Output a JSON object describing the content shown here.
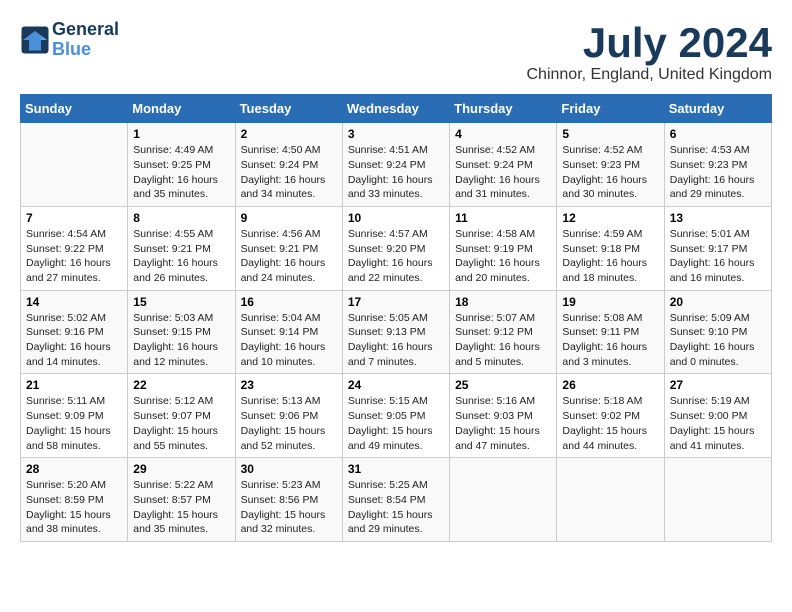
{
  "logo": {
    "line1": "General",
    "line2": "Blue"
  },
  "title": "July 2024",
  "subtitle": "Chinnor, England, United Kingdom",
  "days_of_week": [
    "Sunday",
    "Monday",
    "Tuesday",
    "Wednesday",
    "Thursday",
    "Friday",
    "Saturday"
  ],
  "weeks": [
    [
      {
        "num": "",
        "info": ""
      },
      {
        "num": "1",
        "info": "Sunrise: 4:49 AM\nSunset: 9:25 PM\nDaylight: 16 hours\nand 35 minutes."
      },
      {
        "num": "2",
        "info": "Sunrise: 4:50 AM\nSunset: 9:24 PM\nDaylight: 16 hours\nand 34 minutes."
      },
      {
        "num": "3",
        "info": "Sunrise: 4:51 AM\nSunset: 9:24 PM\nDaylight: 16 hours\nand 33 minutes."
      },
      {
        "num": "4",
        "info": "Sunrise: 4:52 AM\nSunset: 9:24 PM\nDaylight: 16 hours\nand 31 minutes."
      },
      {
        "num": "5",
        "info": "Sunrise: 4:52 AM\nSunset: 9:23 PM\nDaylight: 16 hours\nand 30 minutes."
      },
      {
        "num": "6",
        "info": "Sunrise: 4:53 AM\nSunset: 9:23 PM\nDaylight: 16 hours\nand 29 minutes."
      }
    ],
    [
      {
        "num": "7",
        "info": "Sunrise: 4:54 AM\nSunset: 9:22 PM\nDaylight: 16 hours\nand 27 minutes."
      },
      {
        "num": "8",
        "info": "Sunrise: 4:55 AM\nSunset: 9:21 PM\nDaylight: 16 hours\nand 26 minutes."
      },
      {
        "num": "9",
        "info": "Sunrise: 4:56 AM\nSunset: 9:21 PM\nDaylight: 16 hours\nand 24 minutes."
      },
      {
        "num": "10",
        "info": "Sunrise: 4:57 AM\nSunset: 9:20 PM\nDaylight: 16 hours\nand 22 minutes."
      },
      {
        "num": "11",
        "info": "Sunrise: 4:58 AM\nSunset: 9:19 PM\nDaylight: 16 hours\nand 20 minutes."
      },
      {
        "num": "12",
        "info": "Sunrise: 4:59 AM\nSunset: 9:18 PM\nDaylight: 16 hours\nand 18 minutes."
      },
      {
        "num": "13",
        "info": "Sunrise: 5:01 AM\nSunset: 9:17 PM\nDaylight: 16 hours\nand 16 minutes."
      }
    ],
    [
      {
        "num": "14",
        "info": "Sunrise: 5:02 AM\nSunset: 9:16 PM\nDaylight: 16 hours\nand 14 minutes."
      },
      {
        "num": "15",
        "info": "Sunrise: 5:03 AM\nSunset: 9:15 PM\nDaylight: 16 hours\nand 12 minutes."
      },
      {
        "num": "16",
        "info": "Sunrise: 5:04 AM\nSunset: 9:14 PM\nDaylight: 16 hours\nand 10 minutes."
      },
      {
        "num": "17",
        "info": "Sunrise: 5:05 AM\nSunset: 9:13 PM\nDaylight: 16 hours\nand 7 minutes."
      },
      {
        "num": "18",
        "info": "Sunrise: 5:07 AM\nSunset: 9:12 PM\nDaylight: 16 hours\nand 5 minutes."
      },
      {
        "num": "19",
        "info": "Sunrise: 5:08 AM\nSunset: 9:11 PM\nDaylight: 16 hours\nand 3 minutes."
      },
      {
        "num": "20",
        "info": "Sunrise: 5:09 AM\nSunset: 9:10 PM\nDaylight: 16 hours\nand 0 minutes."
      }
    ],
    [
      {
        "num": "21",
        "info": "Sunrise: 5:11 AM\nSunset: 9:09 PM\nDaylight: 15 hours\nand 58 minutes."
      },
      {
        "num": "22",
        "info": "Sunrise: 5:12 AM\nSunset: 9:07 PM\nDaylight: 15 hours\nand 55 minutes."
      },
      {
        "num": "23",
        "info": "Sunrise: 5:13 AM\nSunset: 9:06 PM\nDaylight: 15 hours\nand 52 minutes."
      },
      {
        "num": "24",
        "info": "Sunrise: 5:15 AM\nSunset: 9:05 PM\nDaylight: 15 hours\nand 49 minutes."
      },
      {
        "num": "25",
        "info": "Sunrise: 5:16 AM\nSunset: 9:03 PM\nDaylight: 15 hours\nand 47 minutes."
      },
      {
        "num": "26",
        "info": "Sunrise: 5:18 AM\nSunset: 9:02 PM\nDaylight: 15 hours\nand 44 minutes."
      },
      {
        "num": "27",
        "info": "Sunrise: 5:19 AM\nSunset: 9:00 PM\nDaylight: 15 hours\nand 41 minutes."
      }
    ],
    [
      {
        "num": "28",
        "info": "Sunrise: 5:20 AM\nSunset: 8:59 PM\nDaylight: 15 hours\nand 38 minutes."
      },
      {
        "num": "29",
        "info": "Sunrise: 5:22 AM\nSunset: 8:57 PM\nDaylight: 15 hours\nand 35 minutes."
      },
      {
        "num": "30",
        "info": "Sunrise: 5:23 AM\nSunset: 8:56 PM\nDaylight: 15 hours\nand 32 minutes."
      },
      {
        "num": "31",
        "info": "Sunrise: 5:25 AM\nSunset: 8:54 PM\nDaylight: 15 hours\nand 29 minutes."
      },
      {
        "num": "",
        "info": ""
      },
      {
        "num": "",
        "info": ""
      },
      {
        "num": "",
        "info": ""
      }
    ]
  ]
}
